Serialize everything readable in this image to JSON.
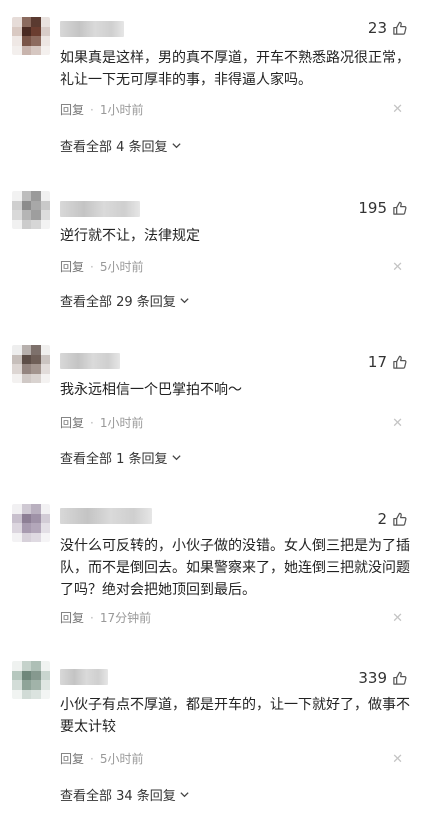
{
  "comments": [
    {
      "likes": "23",
      "text": "如果真是这样，男的真不厚道，开车不熟悉路况很正常，礼让一下无可厚非的事，非得逼人家吗。",
      "reply_label": "回复",
      "time": "1小时前",
      "view_all": "查看全部 4 条回复"
    },
    {
      "likes": "195",
      "text": "逆行就不让，法律规定",
      "reply_label": "回复",
      "time": "5小时前",
      "view_all": "查看全部 29 条回复"
    },
    {
      "likes": "17",
      "text": "我永远相信一个巴掌拍不响～",
      "reply_label": "回复",
      "time": "1小时前",
      "view_all": "查看全部 1 条回复"
    },
    {
      "likes": "2",
      "text": "没什么可反转的，小伙子做的没错。女人倒三把是为了插队，而不是倒回去。如果警察来了，她连倒三把就没问题了吗？绝对会把她顶回到最后。",
      "reply_label": "回复",
      "time": "17分钟前"
    },
    {
      "likes": "339",
      "text": "小伙子有点不厚道，都是开车的，让一下就好了，做事不要太计较",
      "reply_label": "回复",
      "time": "5小时前",
      "view_all": "查看全部 34 条回复"
    }
  ],
  "icons": {
    "like": "thumbs-up-icon",
    "close": "close-icon",
    "expand": "chevron-down-icon"
  },
  "colors": {
    "text": "#222222",
    "meta": "#999999",
    "icon": "#555555"
  }
}
